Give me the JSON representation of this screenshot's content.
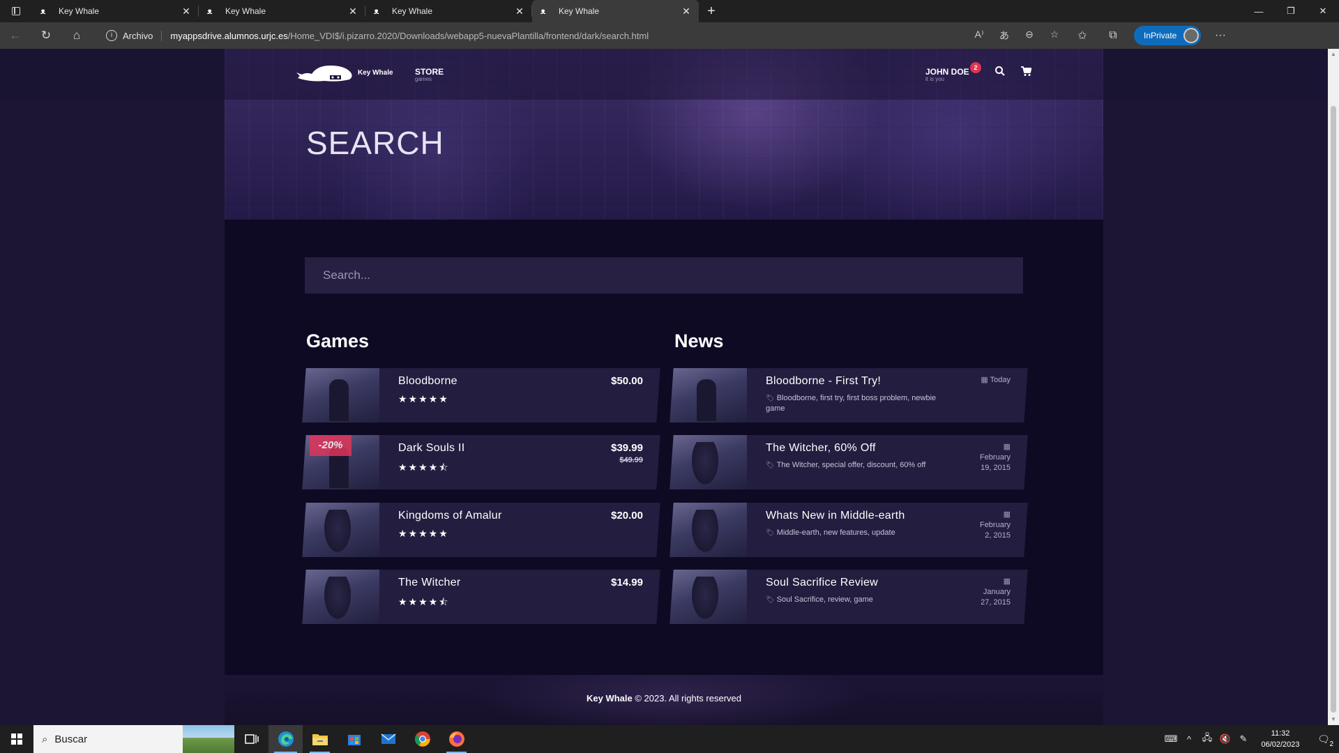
{
  "browser": {
    "tabs": [
      {
        "title": "Key Whale",
        "active": false
      },
      {
        "title": "Key Whale",
        "active": false
      },
      {
        "title": "Key Whale",
        "active": false
      },
      {
        "title": "Key Whale",
        "active": true
      }
    ],
    "address": {
      "protocol_label": "Archivo",
      "host": "myappsdrive.alumnos.urjc.es",
      "path": "/Home_VDI$/i.pizarro.2020/Downloads/webapp5-nuevaPlantilla/frontend/dark/search.html"
    },
    "inprivate_label": "InPrivate"
  },
  "site": {
    "brand": "Key Whale",
    "nav": {
      "store_label": "STORE",
      "store_sub": "games",
      "user_name": "JOHN DOE",
      "user_sub": "it is you",
      "notification_count": "2"
    },
    "hero_title": "SEARCH",
    "search_placeholder": "Search...",
    "games_title": "Games",
    "news_title": "News",
    "games": [
      {
        "name": "Bloodborne",
        "price": "$50.00",
        "old_price": "",
        "discount": "",
        "rating": 5
      },
      {
        "name": "Dark Souls II",
        "price": "$39.99",
        "old_price": "$49.99",
        "discount": "-20%",
        "rating": 4.5
      },
      {
        "name": "Kingdoms of Amalur",
        "price": "$20.00",
        "old_price": "",
        "discount": "",
        "rating": 5
      },
      {
        "name": "The Witcher",
        "price": "$14.99",
        "old_price": "",
        "discount": "",
        "rating": 4.5
      }
    ],
    "news": [
      {
        "title": "Bloodborne - First Try!",
        "tags": "Bloodborne, first try, first boss problem, newbie game",
        "date_line1": "Today",
        "date_line2": ""
      },
      {
        "title": "The Witcher, 60% Off",
        "tags": "The Witcher, special offer, discount, 60% off",
        "date_line1": "February",
        "date_line2": "19, 2015"
      },
      {
        "title": "Whats New in Middle-earth",
        "tags": "Middle-earth, new features, update",
        "date_line1": "February",
        "date_line2": "2, 2015"
      },
      {
        "title": "Soul Sacrifice Review",
        "tags": "Soul Sacrifice, review, game",
        "date_line1": "January",
        "date_line2": "27, 2015"
      }
    ],
    "footer": {
      "brand": "Key Whale",
      "text": " © 2023. All rights reserved"
    }
  },
  "taskbar": {
    "search_placeholder": "Buscar",
    "time": "11:32",
    "date": "06/02/2023",
    "notification_count": "2"
  },
  "colors": {
    "accent_sale": "#e0365a",
    "page_bg": "#0e0a24",
    "card_bg": "#231d3f",
    "inprivate": "#0f6cbd"
  }
}
